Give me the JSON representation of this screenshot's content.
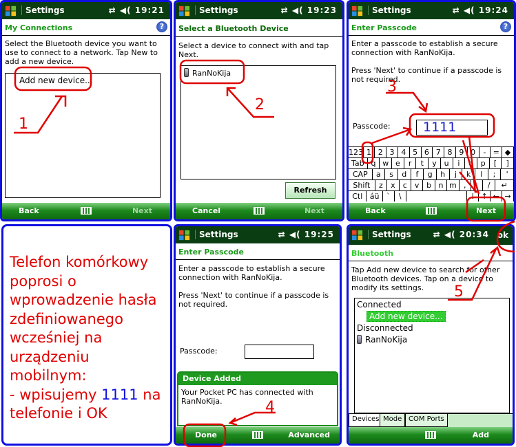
{
  "status": {
    "icons": [
      "sync-arrows-icon",
      "speaker-icon"
    ]
  },
  "screen1": {
    "title": "Settings",
    "time": "19:21",
    "header": "My Connections",
    "desc": "Select the Bluetooth device you want to use to connect to a network. Tap New to add a new device.",
    "list_item": "Add new device...",
    "left_soft": "Back",
    "right_soft": "Next"
  },
  "screen2": {
    "title": "Settings",
    "time": "19:23",
    "header": "Select a Bluetooth Device",
    "desc": "Select a device to connect with and tap Next.",
    "device": "RanNoKija",
    "refresh": "Refresh",
    "left_soft": "Cancel",
    "right_soft": "Next"
  },
  "screen3": {
    "title": "Settings",
    "time": "19:24",
    "header": "Enter Passcode",
    "desc1": "Enter a passcode to establish a secure connection with RanNoKija.",
    "desc2": "Press 'Next' to continue if a passcode is not required.",
    "passcode_label": "Passcode:",
    "passcode_value": "1111",
    "left_soft": "Back",
    "right_soft": "Next",
    "keyboard": [
      [
        "123",
        "1",
        "2",
        "3",
        "4",
        "5",
        "6",
        "7",
        "8",
        "9",
        "0",
        "-",
        "=",
        "◆"
      ],
      [
        "Tab",
        "q",
        "w",
        "e",
        "r",
        "t",
        "y",
        "u",
        "i",
        "o",
        "p",
        "[",
        "]"
      ],
      [
        "CAP",
        "a",
        "s",
        "d",
        "f",
        "g",
        "h",
        "j",
        "k",
        "l",
        ";",
        "'"
      ],
      [
        "Shift",
        "z",
        "x",
        "c",
        "v",
        "b",
        "n",
        "m",
        ",",
        ".",
        "/",
        "↵"
      ],
      [
        "Ctl",
        "áü",
        "`",
        "\\",
        " ",
        "↓",
        "↑",
        "←",
        "→"
      ]
    ]
  },
  "note": {
    "line1": "Telefon komórkowy poprosi o wprowadzenie hasła zdefiniowanego wcześniej na urządzeniu mobilnym:",
    "line2_prefix": "- wpisujemy ",
    "line2_code": "1111",
    "line2_suffix": " na telefonie i OK"
  },
  "screen5": {
    "title": "Settings",
    "time": "19:25",
    "header": "Enter Passcode",
    "desc1": "Enter a passcode to establish a secure connection with RanNoKija.",
    "desc2": "Press 'Next' to continue if a passcode is not required.",
    "passcode_label": "Passcode:",
    "popup_title": "Device Added",
    "popup_text": "Your Pocket PC has connected with RanNoKija.",
    "left_soft": "Done",
    "right_soft": "Advanced"
  },
  "screen6": {
    "title": "Settings",
    "time": "20:34",
    "ok": "ok",
    "header": "Bluetooth",
    "desc": "Tap Add new device to search for other Bluetooth devices. Tap on a device to modify its settings.",
    "group1": "Connected",
    "add_item": "Add new device...",
    "group2": "Disconnected",
    "device": "RanNoKija",
    "tabs": [
      "Devices",
      "Mode",
      "COM Ports"
    ],
    "right_soft": "Add"
  },
  "annotations": [
    "1",
    "2",
    "3",
    "4",
    "5"
  ],
  "colors": {
    "annotation": "#e00000",
    "frame": "#1010e0",
    "title_bar": "#0b3d12",
    "header_text": "#1a9a1a",
    "selection": "#33cc33"
  }
}
